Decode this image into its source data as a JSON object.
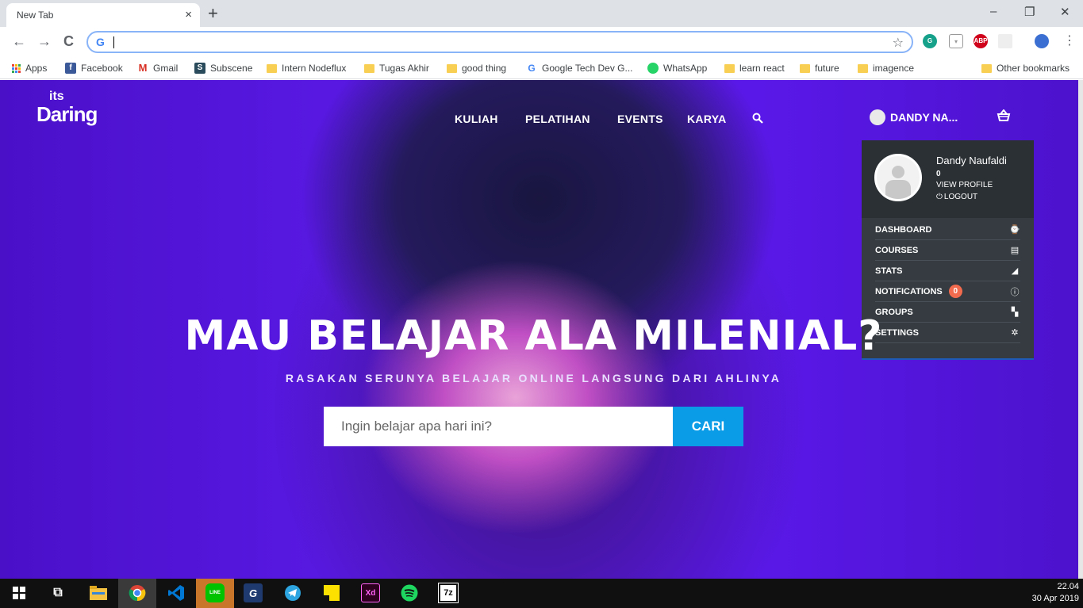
{
  "browser": {
    "tab_title": "New Tab",
    "tab_close": "×",
    "new_tab": "+",
    "window_controls": {
      "minimize": "–",
      "restore": "❐",
      "close": "✕"
    },
    "nav": {
      "back": "←",
      "forward": "→",
      "reload": "C"
    },
    "omnibox_value": "",
    "extensions": [
      "grammarly-icon",
      "shield-icon",
      "adblock-plus-icon",
      "extension-icon",
      "profile-avatar-icon",
      "menu-icon"
    ],
    "abp_label": "ABP",
    "bookmarks": [
      {
        "label": "Apps",
        "icon": "apps-icon"
      },
      {
        "label": "Facebook",
        "icon": "facebook-icon"
      },
      {
        "label": "Gmail",
        "icon": "gmail-icon"
      },
      {
        "label": "Subscene",
        "icon": "subscene-icon"
      },
      {
        "label": "Intern Nodeflux",
        "icon": "folder-icon"
      },
      {
        "label": "Tugas Akhir",
        "icon": "folder-icon"
      },
      {
        "label": "good thing",
        "icon": "folder-icon"
      },
      {
        "label": "Google Tech Dev G...",
        "icon": "google-icon"
      },
      {
        "label": "WhatsApp",
        "icon": "whatsapp-icon"
      },
      {
        "label": "learn react",
        "icon": "folder-icon"
      },
      {
        "label": "future",
        "icon": "folder-icon"
      },
      {
        "label": "imagence",
        "icon": "folder-icon"
      },
      {
        "label": "Other bookmarks",
        "icon": "folder-icon"
      }
    ]
  },
  "site": {
    "logo_top": "its",
    "logo_main": "Daring",
    "nav": [
      "KULIAH",
      "PELATIHAN",
      "EVENTS",
      "KARYA"
    ],
    "user_short": "DANDY NA...",
    "profile": {
      "name": "Dandy Naufaldi",
      "count": "0",
      "view_profile": "VIEW PROFILE",
      "logout": "LOGOUT"
    },
    "menu": [
      {
        "label": "DASHBOARD",
        "icon": "dashboard-icon",
        "glyph": "⌚"
      },
      {
        "label": "COURSES",
        "icon": "book-icon",
        "glyph": "▤"
      },
      {
        "label": "STATS",
        "icon": "stats-icon",
        "glyph": "◢"
      },
      {
        "label": "NOTIFICATIONS",
        "icon": "alert-icon",
        "glyph": "ⓘ",
        "badge": "0"
      },
      {
        "label": "GROUPS",
        "icon": "groups-icon",
        "glyph": "▚"
      },
      {
        "label": "SETTINGS",
        "icon": "gear-icon",
        "glyph": "✲"
      }
    ],
    "hero_title": "MAU BELAJAR ALA MILENIAL?",
    "hero_subtitle": "RASAKAN SERUNYA BELAJAR ONLINE LANGSUNG DARI AHLINYA",
    "search_placeholder": "Ingin belajar apa hari ini?",
    "search_button": "CARI"
  },
  "taskbar": {
    "apps": [
      "windows-start-icon",
      "task-view-icon",
      "file-explorer-icon",
      "chrome-icon",
      "vscode-icon",
      "line-icon",
      "foxit-pdf-icon",
      "telegram-icon",
      "sticky-notes-icon",
      "adobe-xd-icon",
      "spotify-icon",
      "7zip-icon"
    ],
    "labels": {
      "line": "LINE",
      "xd": "Xd",
      "zip": "7z"
    },
    "time": "22.04",
    "date": "30 Apr 2019"
  },
  "colors": {
    "accent_purple": "#5a18e8",
    "search_button": "#0b9ce8",
    "dropdown_bg": "#2b3035",
    "badge": "#f26b4f"
  }
}
